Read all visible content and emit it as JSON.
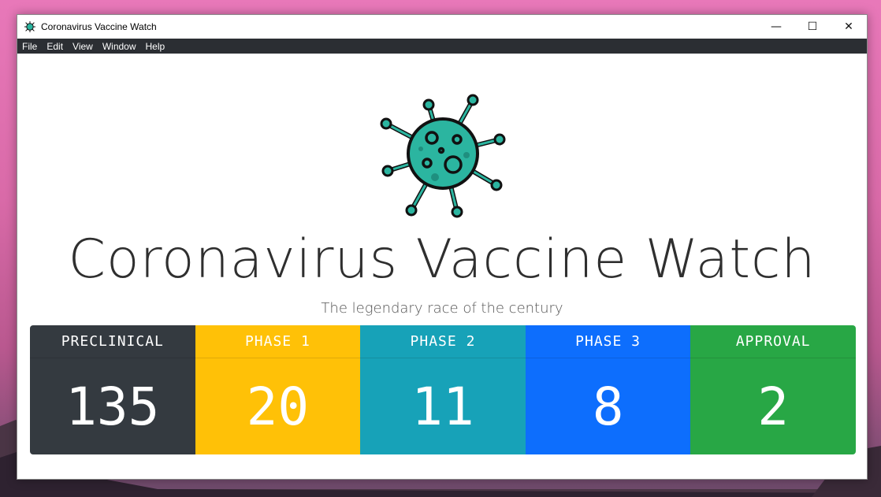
{
  "window": {
    "title": "Coronavirus Vaccine Watch",
    "icon": "virus-icon",
    "controls": {
      "minimize": "—",
      "maximize": "☐",
      "close": "✕"
    }
  },
  "menu": [
    "File",
    "Edit",
    "View",
    "Window",
    "Help"
  ],
  "hero": {
    "icon": "virus-illustration",
    "title": "Coronavirus Vaccine Watch",
    "subtitle": "The legendary race of the century"
  },
  "phases": [
    {
      "label": "PRECLINICAL",
      "value": "135",
      "color": "#343a40"
    },
    {
      "label": "PHASE 1",
      "value": "20",
      "color": "#ffc107"
    },
    {
      "label": "PHASE 2",
      "value": "11",
      "color": "#17a2b8"
    },
    {
      "label": "PHASE 3",
      "value": "8",
      "color": "#0d6efd"
    },
    {
      "label": "APPROVAL",
      "value": "2",
      "color": "#28a745"
    }
  ]
}
